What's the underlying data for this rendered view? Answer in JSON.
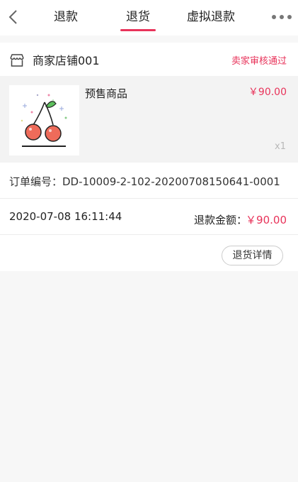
{
  "nav": {
    "tabs": [
      {
        "label": "退款",
        "active": false
      },
      {
        "label": "退货",
        "active": true
      },
      {
        "label": "虚拟退款",
        "active": false
      }
    ],
    "accent_color": "#e8335a"
  },
  "order_card": {
    "shop_name": "商家店铺001",
    "status": "卖家审核通过",
    "goods": {
      "title": "预售商品",
      "price": "￥90.00",
      "quantity": "x1",
      "image_icon": "cherry-icon"
    },
    "order_number": "订单编号：DD-10009-2-102-20200708150641-0001",
    "time": "2020-07-08 16:11:44",
    "refund_label": "退款金额：",
    "refund_amount": "￥90.00",
    "detail_button": "退货详情"
  }
}
